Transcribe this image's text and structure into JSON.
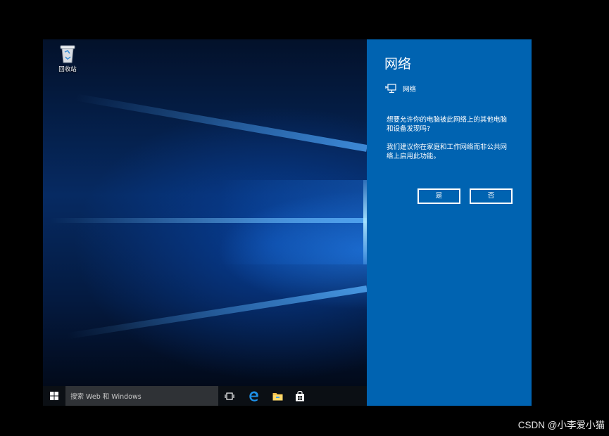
{
  "desktop": {
    "recycle_bin_label": "回收站"
  },
  "taskbar": {
    "search_placeholder": "搜索 Web 和 Windows",
    "icons": [
      "windows-start-icon",
      "task-view-icon",
      "edge-browser-icon",
      "file-explorer-icon",
      "store-icon"
    ]
  },
  "network_flyout": {
    "title": "网络",
    "network_name": "网络",
    "question": "想要允许你的电脑被此网络上的其他电脑和设备发现吗?",
    "recommendation": "我们建议你在家庭和工作网络而非公共网络上启用此功能。",
    "yes_label": "是",
    "no_label": "否"
  },
  "colors": {
    "flyout_bg": "#0063b1",
    "taskbar_bg": "#0b0f14",
    "search_bg": "#2f3236",
    "page_bg": "#000000"
  },
  "watermark": "CSDN @小李爱小猫"
}
